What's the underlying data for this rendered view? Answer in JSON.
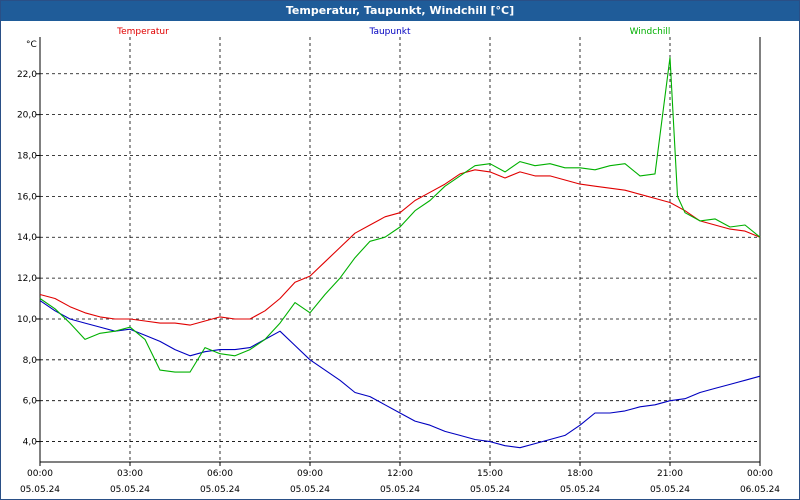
{
  "window": {
    "title": "Temperatur, Taupunkt, Windchill [°C]"
  },
  "chart_data": {
    "type": "line",
    "title": "Temperatur, Taupunkt, Windchill [°C]",
    "ylabel": "°C",
    "ylim": [
      3.0,
      23.8
    ],
    "xlim": [
      "05.05.24 00:00",
      "06.05.24 00:00"
    ],
    "grid": true,
    "legend": "top",
    "x_ticks": [
      {
        "time": "00:00",
        "date": "05.05.24"
      },
      {
        "time": "03:00",
        "date": "05.05.24"
      },
      {
        "time": "06:00",
        "date": "05.05.24"
      },
      {
        "time": "09:00",
        "date": "05.05.24"
      },
      {
        "time": "12:00",
        "date": "05.05.24"
      },
      {
        "time": "15:00",
        "date": "05.05.24"
      },
      {
        "time": "18:00",
        "date": "05.05.24"
      },
      {
        "time": "21:00",
        "date": "05.05.24"
      },
      {
        "time": "00:00",
        "date": "06.05.24"
      }
    ],
    "y_ticks": [
      "4,0",
      "6,0",
      "8,0",
      "10,0",
      "12,0",
      "14,0",
      "16,0",
      "18,0",
      "20,0",
      "22,0"
    ],
    "series": [
      {
        "name": "Temperatur",
        "color": "#e00000",
        "x": [
          "00:00",
          "00:30",
          "01:00",
          "01:30",
          "02:00",
          "02:30",
          "03:00",
          "03:30",
          "04:00",
          "04:30",
          "05:00",
          "05:30",
          "06:00",
          "06:30",
          "07:00",
          "07:30",
          "08:00",
          "08:30",
          "09:00",
          "09:30",
          "10:00",
          "10:30",
          "11:00",
          "11:30",
          "12:00",
          "12:30",
          "13:00",
          "13:30",
          "14:00",
          "14:30",
          "15:00",
          "15:30",
          "16:00",
          "16:30",
          "17:00",
          "17:30",
          "18:00",
          "18:30",
          "19:00",
          "19:30",
          "20:00",
          "20:30",
          "21:00",
          "21:30",
          "22:00",
          "22:30",
          "23:00",
          "23:30",
          "24:00"
        ],
        "values": [
          11.2,
          11.0,
          10.6,
          10.3,
          10.1,
          10.0,
          10.0,
          9.9,
          9.8,
          9.8,
          9.7,
          9.9,
          10.1,
          10.0,
          10.0,
          10.4,
          11.0,
          11.8,
          12.1,
          12.8,
          13.5,
          14.2,
          14.6,
          15.0,
          15.2,
          15.8,
          16.2,
          16.6,
          17.1,
          17.3,
          17.2,
          16.9,
          17.2,
          17.0,
          17.0,
          16.8,
          16.6,
          16.5,
          16.4,
          16.3,
          16.1,
          15.9,
          15.7,
          15.3,
          14.8,
          14.6,
          14.4,
          14.3,
          14.0
        ]
      },
      {
        "name": "Taupunkt",
        "color": "#0000c0",
        "x": [
          "00:00",
          "00:30",
          "01:00",
          "01:30",
          "02:00",
          "02:30",
          "03:00",
          "03:30",
          "04:00",
          "04:30",
          "05:00",
          "05:30",
          "06:00",
          "06:30",
          "07:00",
          "07:30",
          "08:00",
          "08:30",
          "09:00",
          "09:30",
          "10:00",
          "10:30",
          "11:00",
          "11:30",
          "12:00",
          "12:30",
          "13:00",
          "13:30",
          "14:00",
          "14:30",
          "15:00",
          "15:30",
          "16:00",
          "16:30",
          "17:00",
          "17:30",
          "18:00",
          "18:30",
          "19:00",
          "19:30",
          "20:00",
          "20:30",
          "21:00",
          "21:30",
          "22:00",
          "22:30",
          "23:00",
          "23:30",
          "24:00"
        ],
        "values": [
          10.9,
          10.4,
          10.0,
          9.8,
          9.6,
          9.4,
          9.5,
          9.2,
          8.9,
          8.5,
          8.2,
          8.4,
          8.5,
          8.5,
          8.6,
          9.0,
          9.4,
          8.7,
          8.0,
          7.5,
          7.0,
          6.4,
          6.2,
          5.8,
          5.4,
          5.0,
          4.8,
          4.5,
          4.3,
          4.1,
          4.0,
          3.8,
          3.7,
          3.9,
          4.1,
          4.3,
          4.8,
          5.4,
          5.4,
          5.5,
          5.7,
          5.8,
          6.0,
          6.1,
          6.4,
          6.6,
          6.8,
          7.0,
          7.2
        ]
      },
      {
        "name": "Windchill",
        "color": "#00b000",
        "x": [
          "00:00",
          "00:30",
          "01:00",
          "01:30",
          "02:00",
          "02:30",
          "03:00",
          "03:30",
          "04:00",
          "04:30",
          "05:00",
          "05:30",
          "06:00",
          "06:30",
          "07:00",
          "07:30",
          "08:00",
          "08:30",
          "09:00",
          "09:30",
          "10:00",
          "10:30",
          "11:00",
          "11:30",
          "12:00",
          "12:30",
          "13:00",
          "13:30",
          "14:00",
          "14:30",
          "15:00",
          "15:30",
          "16:00",
          "16:30",
          "17:00",
          "17:30",
          "18:00",
          "18:30",
          "19:00",
          "19:30",
          "20:00",
          "20:30",
          "21:00",
          "21:15",
          "21:30",
          "22:00",
          "22:30",
          "23:00",
          "23:30",
          "24:00"
        ],
        "values": [
          11.0,
          10.5,
          9.8,
          9.0,
          9.3,
          9.4,
          9.6,
          9.0,
          7.5,
          7.4,
          7.4,
          8.6,
          8.3,
          8.2,
          8.5,
          9.0,
          9.8,
          10.8,
          10.3,
          11.2,
          12.0,
          13.0,
          13.8,
          14.0,
          14.5,
          15.3,
          15.8,
          16.5,
          17.0,
          17.5,
          17.6,
          17.2,
          17.7,
          17.5,
          17.6,
          17.4,
          17.4,
          17.3,
          17.5,
          17.6,
          17.0,
          17.1,
          22.8,
          16.0,
          15.2,
          14.8,
          14.9,
          14.5,
          14.6,
          14.0
        ]
      }
    ]
  }
}
